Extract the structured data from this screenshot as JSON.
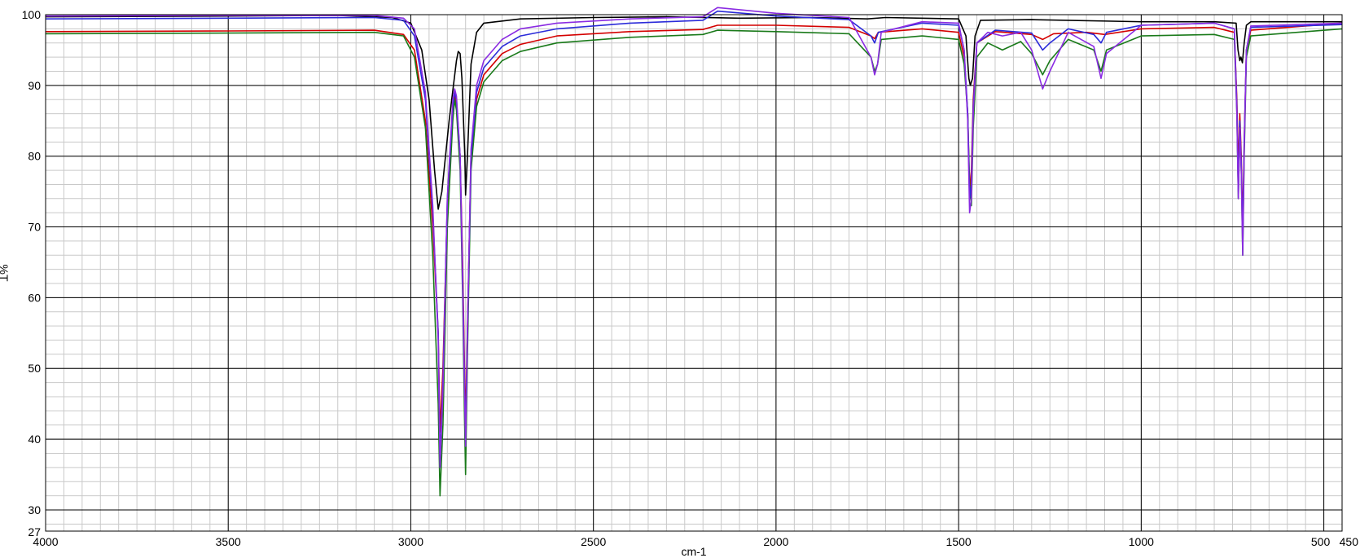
{
  "chart_data": {
    "type": "line",
    "title": "",
    "xlabel": "cm-1",
    "ylabel": "%T",
    "xlim": [
      4000,
      450
    ],
    "ylim": [
      27,
      100
    ],
    "x_reversed": true,
    "grid": true,
    "minor_grid": true,
    "x_ticks": [
      4000,
      3500,
      3000,
      2500,
      2000,
      1500,
      1000,
      500,
      450
    ],
    "x_tick_labels": [
      "4000",
      "3500",
      "3000",
      "2500",
      "2000",
      "1500",
      "1000",
      "500",
      "450"
    ],
    "y_ticks": [
      27,
      30,
      40,
      50,
      60,
      70,
      80,
      90,
      100
    ],
    "y_tick_labels": [
      "27",
      "30",
      "40",
      "50",
      "60",
      "70",
      "80",
      "90",
      "100"
    ],
    "series": [
      {
        "color": "#000000",
        "points": [
          [
            4000,
            99.7
          ],
          [
            3500,
            99.8
          ],
          [
            3200,
            99.9
          ],
          [
            3050,
            99.6
          ],
          [
            3000,
            98.8
          ],
          [
            2970,
            95
          ],
          [
            2950,
            88
          ],
          [
            2935,
            78
          ],
          [
            2925,
            72.5
          ],
          [
            2915,
            75
          ],
          [
            2895,
            85
          ],
          [
            2875,
            93.5
          ],
          [
            2870,
            94.8
          ],
          [
            2865,
            94.5
          ],
          [
            2860,
            91
          ],
          [
            2852,
            80
          ],
          [
            2850,
            74.5
          ],
          [
            2845,
            80
          ],
          [
            2835,
            93
          ],
          [
            2820,
            97.5
          ],
          [
            2800,
            98.8
          ],
          [
            2700,
            99.4
          ],
          [
            2500,
            99.6
          ],
          [
            2300,
            99.7
          ],
          [
            2100,
            99.5
          ],
          [
            1900,
            99.6
          ],
          [
            1750,
            99.4
          ],
          [
            1700,
            99.6
          ],
          [
            1500,
            99.4
          ],
          [
            1480,
            97
          ],
          [
            1472,
            91
          ],
          [
            1468,
            90
          ],
          [
            1462,
            91
          ],
          [
            1455,
            97
          ],
          [
            1440,
            99.2
          ],
          [
            1300,
            99.3
          ],
          [
            1000,
            99
          ],
          [
            800,
            99
          ],
          [
            740,
            98.8
          ],
          [
            735,
            95
          ],
          [
            730,
            93.5
          ],
          [
            727,
            94
          ],
          [
            723,
            93.2
          ],
          [
            718,
            96
          ],
          [
            712,
            98.5
          ],
          [
            700,
            99
          ],
          [
            450,
            99
          ]
        ]
      },
      {
        "color": "#d40000",
        "points": [
          [
            4000,
            97.6
          ],
          [
            3500,
            97.7
          ],
          [
            3100,
            97.8
          ],
          [
            3020,
            97.2
          ],
          [
            2990,
            95
          ],
          [
            2960,
            85
          ],
          [
            2940,
            70
          ],
          [
            2925,
            55
          ],
          [
            2920,
            41
          ],
          [
            2912,
            50
          ],
          [
            2900,
            73
          ],
          [
            2885,
            86
          ],
          [
            2880,
            88.5
          ],
          [
            2875,
            87
          ],
          [
            2865,
            80
          ],
          [
            2858,
            65
          ],
          [
            2853,
            50
          ],
          [
            2850,
            42
          ],
          [
            2845,
            56
          ],
          [
            2835,
            80
          ],
          [
            2820,
            88
          ],
          [
            2800,
            91.5
          ],
          [
            2750,
            94.5
          ],
          [
            2700,
            95.8
          ],
          [
            2600,
            97
          ],
          [
            2400,
            97.6
          ],
          [
            2200,
            97.9
          ],
          [
            2160,
            98.5
          ],
          [
            2000,
            98.5
          ],
          [
            1800,
            98.2
          ],
          [
            1740,
            97
          ],
          [
            1730,
            96.6
          ],
          [
            1720,
            97.5
          ],
          [
            1600,
            98
          ],
          [
            1500,
            97.5
          ],
          [
            1485,
            94
          ],
          [
            1475,
            86
          ],
          [
            1470,
            75
          ],
          [
            1465,
            78
          ],
          [
            1460,
            88
          ],
          [
            1450,
            96
          ],
          [
            1400,
            97.6
          ],
          [
            1300,
            97.2
          ],
          [
            1270,
            96.5
          ],
          [
            1240,
            97.3
          ],
          [
            1150,
            97.5
          ],
          [
            1100,
            97.2
          ],
          [
            1000,
            98
          ],
          [
            800,
            98.2
          ],
          [
            745,
            97.5
          ],
          [
            738,
            88
          ],
          [
            734,
            78
          ],
          [
            730,
            86
          ],
          [
            726,
            80
          ],
          [
            722,
            70
          ],
          [
            718,
            82
          ],
          [
            712,
            95
          ],
          [
            700,
            97.8
          ],
          [
            450,
            98.8
          ]
        ]
      },
      {
        "color": "#1a7a1a",
        "points": [
          [
            4000,
            97.3
          ],
          [
            3500,
            97.4
          ],
          [
            3100,
            97.5
          ],
          [
            3020,
            97
          ],
          [
            2990,
            94
          ],
          [
            2960,
            84
          ],
          [
            2940,
            66
          ],
          [
            2925,
            45
          ],
          [
            2920,
            32
          ],
          [
            2912,
            42
          ],
          [
            2900,
            70
          ],
          [
            2885,
            85
          ],
          [
            2880,
            88
          ],
          [
            2875,
            86.5
          ],
          [
            2865,
            78
          ],
          [
            2858,
            60
          ],
          [
            2853,
            43
          ],
          [
            2850,
            35
          ],
          [
            2845,
            52
          ],
          [
            2835,
            78
          ],
          [
            2820,
            87
          ],
          [
            2800,
            90.5
          ],
          [
            2750,
            93.5
          ],
          [
            2700,
            94.8
          ],
          [
            2600,
            96
          ],
          [
            2400,
            96.8
          ],
          [
            2200,
            97.2
          ],
          [
            2160,
            97.8
          ],
          [
            2000,
            97.6
          ],
          [
            1800,
            97.3
          ],
          [
            1740,
            94
          ],
          [
            1730,
            92
          ],
          [
            1722,
            93
          ],
          [
            1712,
            96.5
          ],
          [
            1600,
            97
          ],
          [
            1500,
            96.5
          ],
          [
            1485,
            93
          ],
          [
            1475,
            86
          ],
          [
            1470,
            76
          ],
          [
            1465,
            73
          ],
          [
            1460,
            84
          ],
          [
            1450,
            94
          ],
          [
            1420,
            96
          ],
          [
            1380,
            95
          ],
          [
            1330,
            96.2
          ],
          [
            1300,
            94.5
          ],
          [
            1270,
            91.5
          ],
          [
            1250,
            93.5
          ],
          [
            1200,
            96.5
          ],
          [
            1130,
            95
          ],
          [
            1110,
            92
          ],
          [
            1095,
            95
          ],
          [
            1000,
            97
          ],
          [
            800,
            97.2
          ],
          [
            745,
            96.5
          ],
          [
            738,
            86
          ],
          [
            734,
            74
          ],
          [
            730,
            84
          ],
          [
            726,
            78
          ],
          [
            722,
            66
          ],
          [
            718,
            80
          ],
          [
            712,
            94
          ],
          [
            700,
            97
          ],
          [
            450,
            98
          ]
        ]
      },
      {
        "color": "#2b2bd9",
        "points": [
          [
            4000,
            99.4
          ],
          [
            3500,
            99.5
          ],
          [
            3100,
            99.6
          ],
          [
            3020,
            99.2
          ],
          [
            2990,
            97
          ],
          [
            2960,
            88
          ],
          [
            2940,
            72
          ],
          [
            2925,
            55
          ],
          [
            2920,
            37
          ],
          [
            2912,
            48
          ],
          [
            2900,
            74
          ],
          [
            2885,
            87
          ],
          [
            2880,
            89
          ],
          [
            2875,
            88
          ],
          [
            2865,
            80
          ],
          [
            2858,
            63
          ],
          [
            2853,
            48
          ],
          [
            2850,
            40
          ],
          [
            2845,
            55
          ],
          [
            2835,
            80
          ],
          [
            2820,
            89
          ],
          [
            2800,
            92.5
          ],
          [
            2750,
            95.5
          ],
          [
            2700,
            97
          ],
          [
            2600,
            98
          ],
          [
            2400,
            98.8
          ],
          [
            2200,
            99.2
          ],
          [
            2160,
            100.5
          ],
          [
            2000,
            99.8
          ],
          [
            1800,
            99.3
          ],
          [
            1740,
            97
          ],
          [
            1730,
            96
          ],
          [
            1720,
            97.5
          ],
          [
            1600,
            98.8
          ],
          [
            1500,
            98.5
          ],
          [
            1485,
            95
          ],
          [
            1475,
            86
          ],
          [
            1470,
            74
          ],
          [
            1465,
            76
          ],
          [
            1460,
            87
          ],
          [
            1450,
            96
          ],
          [
            1400,
            97.8
          ],
          [
            1300,
            97.4
          ],
          [
            1270,
            95
          ],
          [
            1250,
            96
          ],
          [
            1200,
            98
          ],
          [
            1130,
            97.2
          ],
          [
            1110,
            96
          ],
          [
            1095,
            97.5
          ],
          [
            1000,
            98.5
          ],
          [
            800,
            98.8
          ],
          [
            745,
            98
          ],
          [
            738,
            87
          ],
          [
            734,
            75
          ],
          [
            730,
            85
          ],
          [
            726,
            79
          ],
          [
            722,
            68
          ],
          [
            718,
            82
          ],
          [
            712,
            95
          ],
          [
            700,
            98.2
          ],
          [
            450,
            98.6
          ]
        ]
      },
      {
        "color": "#8a2be2",
        "points": [
          [
            4000,
            99.8
          ],
          [
            3500,
            99.9
          ],
          [
            3100,
            99.9
          ],
          [
            3020,
            99.5
          ],
          [
            2990,
            98
          ],
          [
            2960,
            89
          ],
          [
            2940,
            73
          ],
          [
            2925,
            54
          ],
          [
            2920,
            36
          ],
          [
            2912,
            47
          ],
          [
            2900,
            74
          ],
          [
            2885,
            88
          ],
          [
            2880,
            89.5
          ],
          [
            2875,
            88.5
          ],
          [
            2865,
            80
          ],
          [
            2858,
            62
          ],
          [
            2853,
            47
          ],
          [
            2850,
            39
          ],
          [
            2845,
            55
          ],
          [
            2835,
            81
          ],
          [
            2820,
            90
          ],
          [
            2800,
            93.5
          ],
          [
            2750,
            96.5
          ],
          [
            2700,
            98
          ],
          [
            2600,
            98.8
          ],
          [
            2400,
            99.4
          ],
          [
            2200,
            99.7
          ],
          [
            2160,
            101
          ],
          [
            2000,
            100.2
          ],
          [
            1800,
            99.6
          ],
          [
            1740,
            94
          ],
          [
            1730,
            91.5
          ],
          [
            1722,
            93
          ],
          [
            1712,
            97.5
          ],
          [
            1600,
            99
          ],
          [
            1500,
            98.8
          ],
          [
            1485,
            95
          ],
          [
            1475,
            85
          ],
          [
            1470,
            72
          ],
          [
            1465,
            74
          ],
          [
            1460,
            86
          ],
          [
            1450,
            96
          ],
          [
            1420,
            97.5
          ],
          [
            1380,
            97
          ],
          [
            1330,
            97.5
          ],
          [
            1300,
            95
          ],
          [
            1270,
            89.5
          ],
          [
            1250,
            92
          ],
          [
            1200,
            97.5
          ],
          [
            1130,
            95.5
          ],
          [
            1110,
            91
          ],
          [
            1095,
            94.5
          ],
          [
            1000,
            98.5
          ],
          [
            800,
            98.8
          ],
          [
            745,
            98
          ],
          [
            738,
            86
          ],
          [
            734,
            74
          ],
          [
            730,
            84
          ],
          [
            726,
            78
          ],
          [
            722,
            66
          ],
          [
            718,
            81
          ],
          [
            712,
            95
          ],
          [
            700,
            98.4
          ],
          [
            450,
            98.8
          ]
        ]
      }
    ]
  }
}
